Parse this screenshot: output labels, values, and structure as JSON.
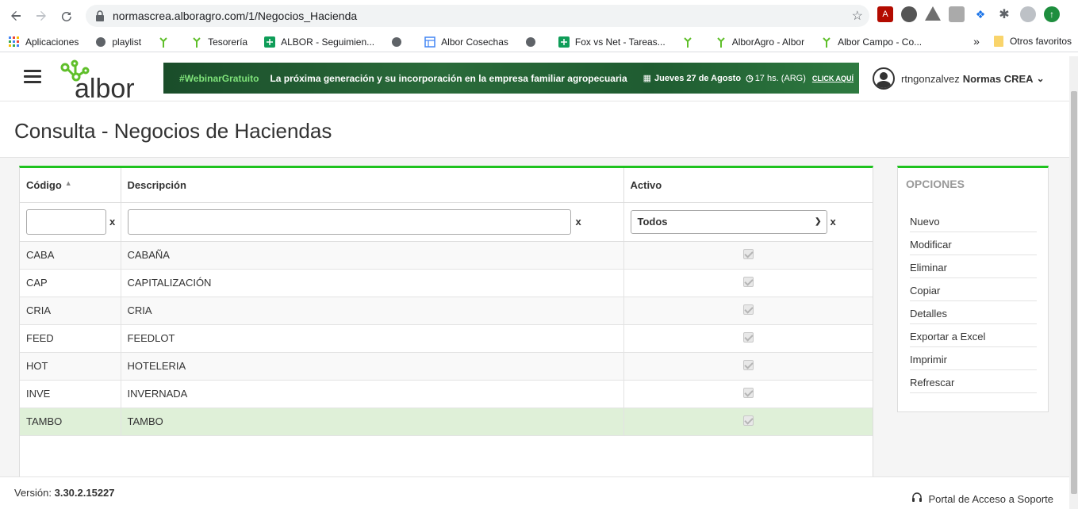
{
  "browser": {
    "url": "normascrea.alboragro.com/1/Negocios_Hacienda",
    "bookmarks": [
      {
        "label": "Aplicaciones",
        "icon": "apps-grid-icon"
      },
      {
        "label": "playlist",
        "icon": "globe-icon"
      },
      {
        "label": "",
        "icon": "albor-sprout-icon"
      },
      {
        "label": "Tesorería",
        "icon": "albor-sprout-icon"
      },
      {
        "label": "ALBOR - Seguimien...",
        "icon": "sheets-icon"
      },
      {
        "label": "",
        "icon": "globe-icon"
      },
      {
        "label": "Albor Cosechas",
        "icon": "calendar-icon"
      },
      {
        "label": "",
        "icon": "globe-icon"
      },
      {
        "label": "Fox vs Net - Tareas...",
        "icon": "sheets-icon"
      },
      {
        "label": "",
        "icon": "albor-sprout-icon"
      },
      {
        "label": "AlborAgro - Albor",
        "icon": "albor-sprout-icon"
      },
      {
        "label": "Albor Campo - Co...",
        "icon": "albor-sprout-icon"
      }
    ],
    "more": "»",
    "other_bookmarks": "Otros favoritos"
  },
  "header": {
    "logo_text": "albor",
    "banner": {
      "tag": "#WebinarGratuito",
      "text": "La próxima generación y su incorporación en la empresa familiar agropecuaria",
      "date": "Jueves 27 de Agosto",
      "time": "17 hs. (ARG)",
      "cta": "CLICK AQUÍ"
    },
    "user": {
      "username": "rtngonzalvez",
      "org": "Normas CREA"
    }
  },
  "page": {
    "title": "Consulta - Negocios de Haciendas"
  },
  "grid": {
    "columns": {
      "codigo": "Código",
      "descripcion": "Descripción",
      "activo": "Activo"
    },
    "filter": {
      "clear": "x",
      "activo_selected": "Todos"
    },
    "rows": [
      {
        "codigo": "CABA",
        "descripcion": "CABAÑA"
      },
      {
        "codigo": "CAP",
        "descripcion": "CAPITALIZACIÓN"
      },
      {
        "codigo": "CRIA",
        "descripcion": "CRIA"
      },
      {
        "codigo": "FEED",
        "descripcion": "FEEDLOT"
      },
      {
        "codigo": "HOT",
        "descripcion": "HOTELERIA"
      },
      {
        "codigo": "INVE",
        "descripcion": "INVERNADA"
      },
      {
        "codigo": "TAMBO",
        "descripcion": "TAMBO"
      }
    ]
  },
  "options": {
    "title": "OPCIONES",
    "items": [
      "Nuevo",
      "Modificar",
      "Eliminar",
      "Copiar",
      "Detalles",
      "Exportar a Excel",
      "Imprimir",
      "Refrescar"
    ]
  },
  "footer": {
    "version_label": "Versión:",
    "version": "3.30.2.15227",
    "support": "Portal de Acceso a Soporte"
  },
  "colors": {
    "accent": "#1ec31e",
    "selected_row": "#dff0d8"
  }
}
